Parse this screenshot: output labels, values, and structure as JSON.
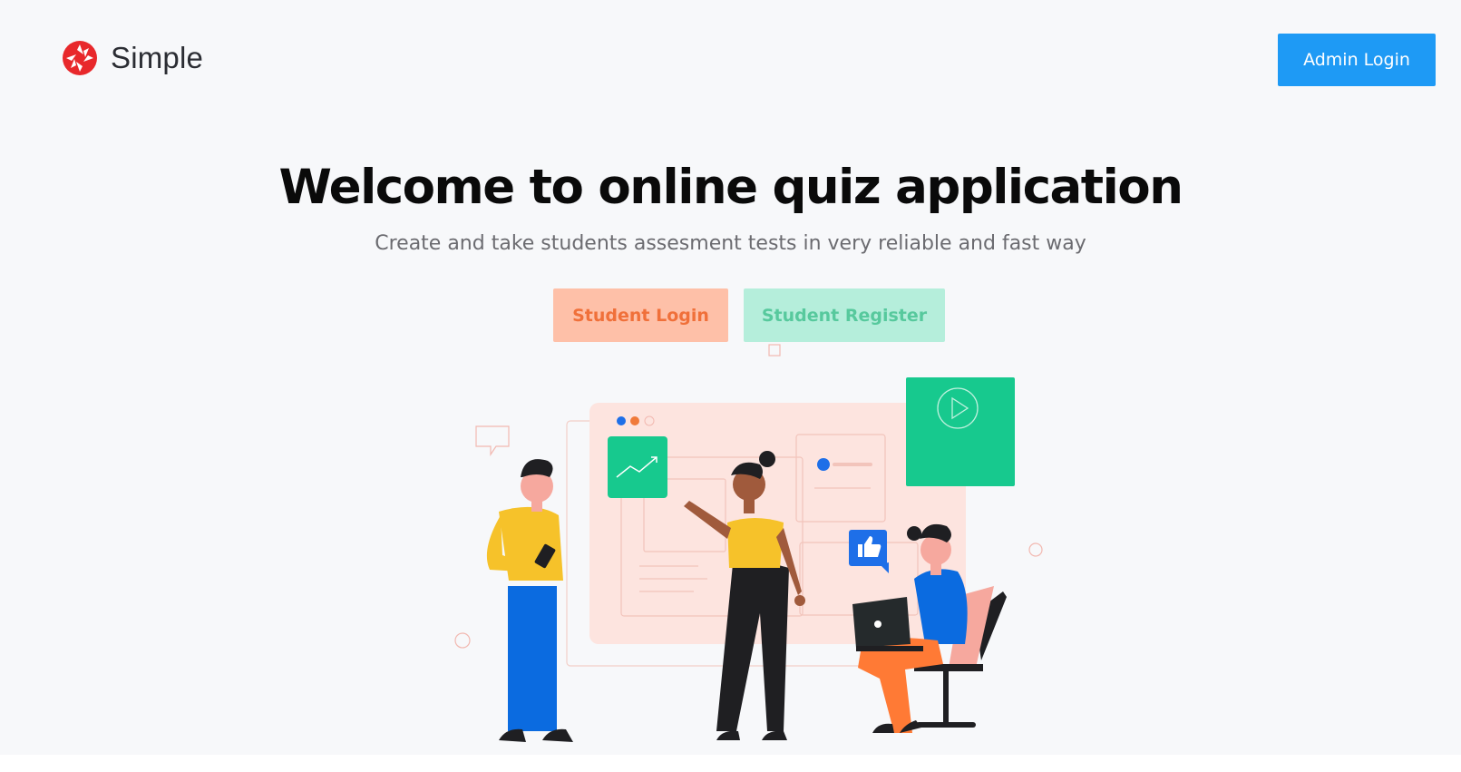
{
  "header": {
    "brand_name": "Simple",
    "logo_icon": "aperture-icon",
    "admin_login_label": "Admin Login"
  },
  "hero": {
    "title": "Welcome to online quiz application",
    "subtitle": "Create and take students assesment tests in very reliable and fast way",
    "student_login_label": "Student Login",
    "student_register_label": "Student Register"
  },
  "illustration": {
    "icons": [
      "chart-icon",
      "play-icon",
      "thumbs-up-icon",
      "chat-bubble-icon"
    ]
  },
  "colors": {
    "background": "#f7f8fa",
    "admin_button": "#1e9af5",
    "student_login_bg": "#fec0a8",
    "student_login_text": "#f0703a",
    "student_register_bg": "#b5eedb",
    "student_register_text": "#57c99d",
    "brand_logo": "#e8282b"
  }
}
